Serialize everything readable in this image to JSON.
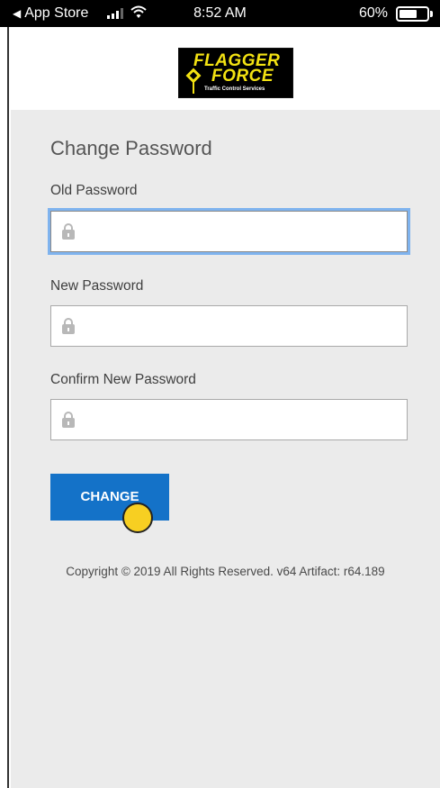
{
  "status_bar": {
    "back_label": "App Store",
    "time": "8:52 AM",
    "battery_percent": "60%",
    "battery_level": 0.6
  },
  "brand": {
    "logo_line1": "FLAGGER",
    "logo_line2": "FORCE",
    "logo_tagline": "Traffic Control Services",
    "logo_bg": "#000000",
    "logo_color": "#f3e212"
  },
  "form": {
    "title": "Change Password",
    "fields": [
      {
        "label": "Old Password",
        "value": "",
        "focused": true,
        "icon": "lock-icon"
      },
      {
        "label": "New Password",
        "value": "",
        "focused": false,
        "icon": "lock-icon"
      },
      {
        "label": "Confirm New Password",
        "value": "",
        "focused": false,
        "icon": "lock-icon"
      }
    ],
    "submit_label": "CHANGE",
    "accent_color": "#1472c8",
    "focus_ring_color": "#7fb3ee"
  },
  "footer": {
    "copyright": "Copyright © 2019 All Rights Reserved. v64 Artifact: r64.189"
  }
}
